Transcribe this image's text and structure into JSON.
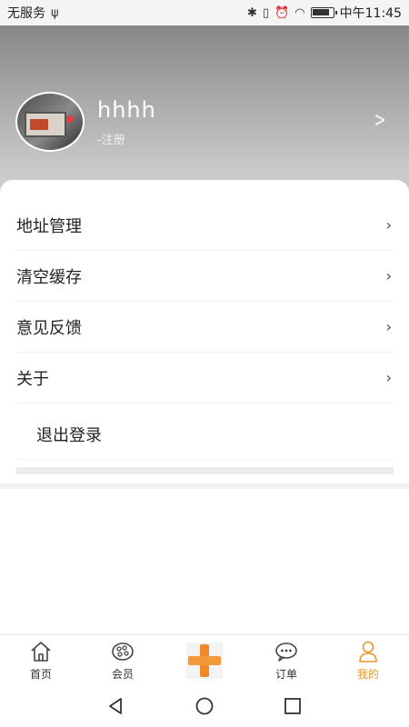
{
  "status_bar": {
    "carrier": "无服务",
    "time": "中午11:45"
  },
  "profile": {
    "username": "hhhh",
    "subtitle": "-注册"
  },
  "menu": {
    "items": [
      {
        "label": "地址管理"
      },
      {
        "label": "清空缓存"
      },
      {
        "label": "意见反馈"
      },
      {
        "label": "关于"
      }
    ],
    "logout_label": "退出登录"
  },
  "bottom_nav": {
    "items": [
      {
        "label": "首页",
        "icon": "home-icon"
      },
      {
        "label": "会员",
        "icon": "palette-icon"
      },
      {
        "label": "",
        "icon": "plus-icon"
      },
      {
        "label": "订单",
        "icon": "chat-icon"
      },
      {
        "label": "我的",
        "icon": "user-icon"
      }
    ],
    "active_index": 4,
    "accent_color": "#e8962a"
  }
}
